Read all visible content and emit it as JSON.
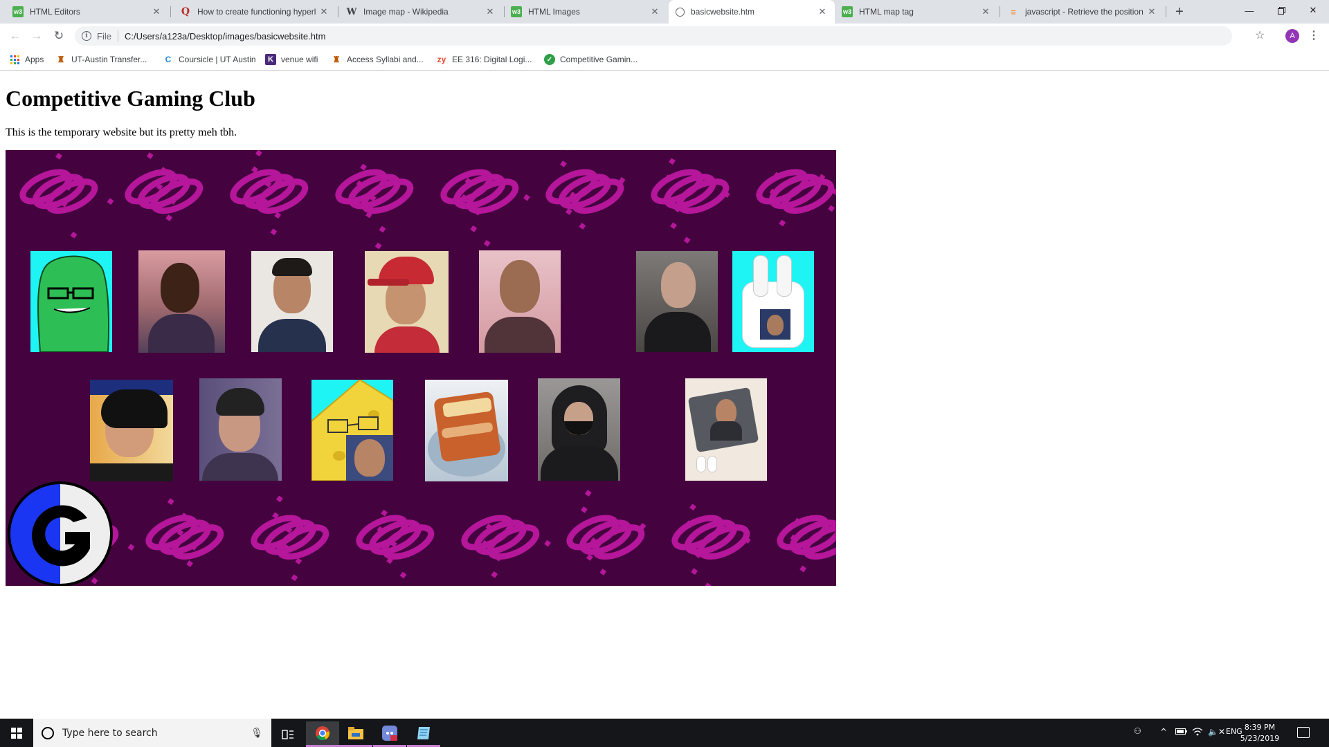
{
  "browser": {
    "tabs": [
      {
        "title": "HTML Editors",
        "favicon": "w3schools-icon",
        "active": false
      },
      {
        "title": "How to create functioning hyperl",
        "favicon": "quora-icon",
        "active": false
      },
      {
        "title": "Image map - Wikipedia",
        "favicon": "wikipedia-icon",
        "active": false
      },
      {
        "title": "HTML Images",
        "favicon": "w3schools-icon",
        "active": false
      },
      {
        "title": "basicwebsite.htm",
        "favicon": "globe-icon",
        "active": true
      },
      {
        "title": "HTML map tag",
        "favicon": "w3schools-icon",
        "active": false
      },
      {
        "title": "javascript - Retrieve the position",
        "favicon": "stackoverflow-icon",
        "active": false
      }
    ],
    "address": {
      "scheme_label": "File",
      "url": "C:/Users/a123a/Desktop/images/basicwebsite.htm"
    },
    "avatar_letter": "A",
    "bookmarks": [
      {
        "label": "Apps",
        "icon": "apps-grid-icon"
      },
      {
        "label": "UT-Austin Transfer...",
        "icon": "ut-icon"
      },
      {
        "label": "Coursicle | UT Austin",
        "icon": "coursicle-icon"
      },
      {
        "label": "venue wifi",
        "icon": "k-icon"
      },
      {
        "label": "Access Syllabi and...",
        "icon": "ut-icon"
      },
      {
        "label": "EE 316: Digital Logi...",
        "icon": "zybooks-icon"
      },
      {
        "label": "Competitive Gamin...",
        "icon": "check-icon"
      }
    ]
  },
  "page": {
    "heading": "Competitive Gaming Club",
    "paragraph": "This is the temporary website but its pretty meh tbh.",
    "image_map_background": "#44033f",
    "streamer_color": "#b5169a"
  },
  "taskbar": {
    "search_placeholder": "Type here to search",
    "language": "ENG",
    "time": "8:39 PM",
    "date": "5/23/2019"
  }
}
